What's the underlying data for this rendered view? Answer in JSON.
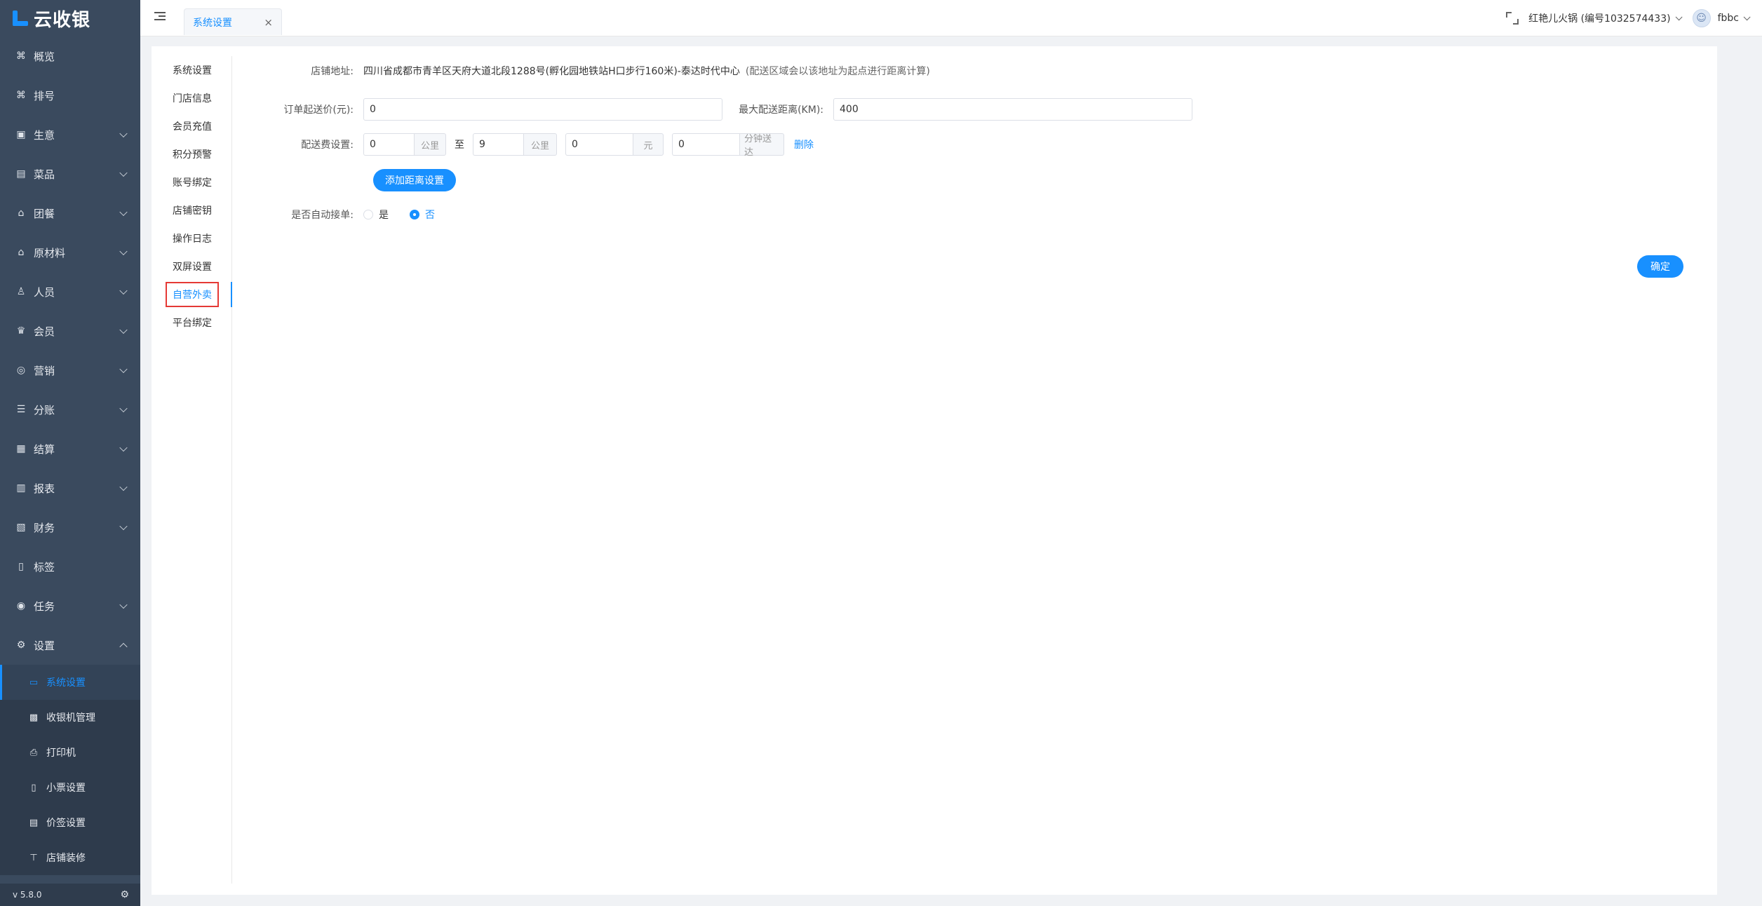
{
  "app": {
    "name": "云收银",
    "version": "v 5.8.0"
  },
  "sidebar": {
    "items": [
      {
        "label": "概览",
        "icon": "overview-icon",
        "glyph": "⌘",
        "arrow": false
      },
      {
        "label": "排号",
        "icon": "queue-icon",
        "glyph": "⌘",
        "arrow": false
      },
      {
        "label": "生意",
        "icon": "business-icon",
        "glyph": "▣",
        "arrow": true
      },
      {
        "label": "菜品",
        "icon": "dishes-icon",
        "glyph": "▤",
        "arrow": true
      },
      {
        "label": "团餐",
        "icon": "group-meal-icon",
        "glyph": "⌂",
        "arrow": true
      },
      {
        "label": "原材料",
        "icon": "material-icon",
        "glyph": "⌂",
        "arrow": true
      },
      {
        "label": "人员",
        "icon": "staff-icon",
        "glyph": "♙",
        "arrow": true
      },
      {
        "label": "会员",
        "icon": "member-icon",
        "glyph": "♛",
        "arrow": true
      },
      {
        "label": "营销",
        "icon": "marketing-icon",
        "glyph": "◎",
        "arrow": true
      },
      {
        "label": "分账",
        "icon": "split-account-icon",
        "glyph": "☰",
        "arrow": true
      },
      {
        "label": "结算",
        "icon": "settlement-icon",
        "glyph": "▦",
        "arrow": true
      },
      {
        "label": "报表",
        "icon": "report-icon",
        "glyph": "▥",
        "arrow": true
      },
      {
        "label": "财务",
        "icon": "finance-icon",
        "glyph": "▧",
        "arrow": true
      },
      {
        "label": "标签",
        "icon": "tag-icon",
        "glyph": "▯",
        "arrow": false
      },
      {
        "label": "任务",
        "icon": "task-icon",
        "glyph": "◉",
        "arrow": true
      },
      {
        "label": "设置",
        "icon": "settings-icon",
        "glyph": "⚙",
        "arrow": true
      }
    ],
    "sub_items": [
      {
        "label": "系统设置",
        "icon": "monitor-icon",
        "glyph": "▭",
        "active": true
      },
      {
        "label": "收银机管理",
        "icon": "cash-register-icon",
        "glyph": "▩",
        "active": false
      },
      {
        "label": "打印机",
        "icon": "printer-icon",
        "glyph": "⎙",
        "active": false
      },
      {
        "label": "小票设置",
        "icon": "receipt-icon",
        "glyph": "▯",
        "active": false
      },
      {
        "label": "价签设置",
        "icon": "price-tag-icon",
        "glyph": "▤",
        "active": false
      },
      {
        "label": "店铺装修",
        "icon": "decoration-icon",
        "glyph": "⊤",
        "active": false
      }
    ]
  },
  "header": {
    "tab_label": "系统设置",
    "tab_close": "×",
    "store": "红艳儿火锅 (编号1032574433)",
    "user": "fbbc"
  },
  "settings_nav": [
    "系统设置",
    "门店信息",
    "会员充值",
    "积分预警",
    "账号绑定",
    "店铺密钥",
    "操作日志",
    "双屏设置",
    "自营外卖",
    "平台绑定"
  ],
  "settings_nav_active": "自营外卖",
  "form": {
    "address_label": "店铺地址:",
    "address_value": "四川省成都市青羊区天府大道北段1288号(孵化园地铁站H口步行160米)-泰达时代中心",
    "address_hint": "(配送区域会以该地址为起点进行距离计算)",
    "min_order_label": "订单起送价(元):",
    "min_order_value": "0",
    "max_distance_label": "最大配送距离(KM):",
    "max_distance_value": "400",
    "fee_label": "配送费设置:",
    "fee_from_value": "0",
    "fee_from_unit": "公里",
    "fee_to_sep": "至",
    "fee_to_value": "9",
    "fee_to_unit": "公里",
    "fee_price_value": "0",
    "fee_price_unit": "元",
    "fee_time_value": "0",
    "fee_time_unit": "分钟送达",
    "delete_label": "删除",
    "add_distance_button": "添加距离设置",
    "auto_accept_label": "是否自动接单:",
    "auto_accept_yes": "是",
    "auto_accept_no": "否",
    "auto_accept_selected": "否",
    "confirm_button": "确定"
  },
  "colors": {
    "accent": "#1890ff",
    "sidebar_bg": "#3a4a5e",
    "highlight_box": "#e53935"
  }
}
